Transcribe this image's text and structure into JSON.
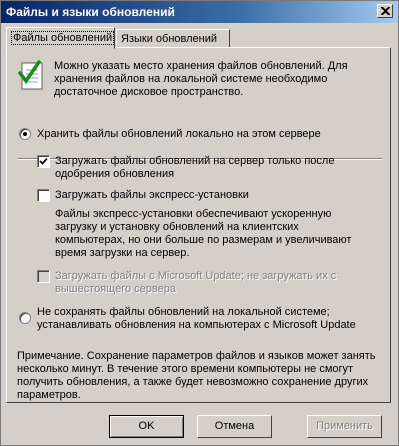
{
  "window": {
    "title": "Файлы и языки обновлений"
  },
  "tabs": [
    {
      "label": "Файлы обновлений",
      "active": true
    },
    {
      "label": "Языки обновлений",
      "active": false
    }
  ],
  "info": {
    "icon": "notepad-check-icon",
    "lines": [
      "Можно указать место хранения файлов обновлений. Для",
      "хранения файлов на локальной системе необходимо",
      "достаточное дисковое пространство."
    ]
  },
  "options": {
    "store_local": {
      "label": "Хранить файлы обновлений локально на этом сервере",
      "selected": true
    },
    "download_after_approval": {
      "lines": [
        "Загружать файлы обновлений на сервер только после",
        "одобрения обновления"
      ],
      "checked": true
    },
    "download_express": {
      "label": "Загружать файлы экспресс-установки",
      "checked": false,
      "description": [
        "Файлы экспресс-установки обеспечивают ускоренную",
        "загрузку и установку обновлений на клиентских",
        "компьютерах, но они больше по размерам и увеличивают",
        "время загрузки на сервер."
      ]
    },
    "from_microsoft_update": {
      "lines": [
        "Загружать файлы с Microsoft Update; не загружать их с",
        "вышестоящего сервера"
      ],
      "checked": false,
      "enabled": false
    },
    "no_store": {
      "lines": [
        "Не сохранять файлы обновлений на локальной системе;",
        "устанавливать обновления на компьютерах с Microsoft Update"
      ],
      "selected": false
    }
  },
  "note": {
    "lines": [
      "Примечание. Сохранение параметров файлов и языков может занять",
      "несколько минут. В течение этого времени компьютеры не смогут",
      "получить обновления, а также будет невозможно сохранение других",
      "параметров."
    ]
  },
  "buttons": {
    "ok": "OK",
    "cancel": "Отмена",
    "apply": "Применить"
  }
}
